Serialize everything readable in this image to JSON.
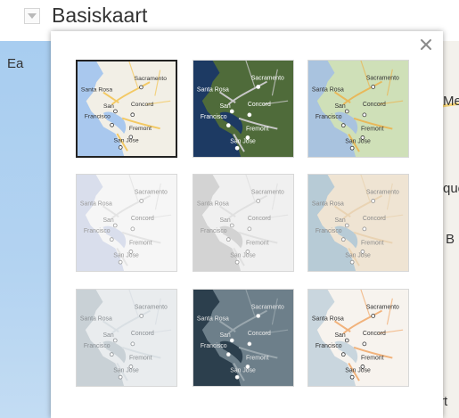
{
  "header": {
    "title": "Basiskaart"
  },
  "background_labels": [
    "Ea",
    "Me",
    "que",
    "B",
    "rt"
  ],
  "tile_labels": [
    "Sacramento",
    "Santa Rosa",
    "San",
    "Francisco",
    "Concord",
    "Fremont",
    "San Jose"
  ],
  "map_styles": [
    {
      "id": "standard",
      "selected": true,
      "water": "#a9c8ee",
      "land": "#f2efe6",
      "road": "#f3c964",
      "text": "#333333"
    },
    {
      "id": "satellite",
      "selected": false,
      "water": "#1d3a63",
      "land": "#4f6b3a",
      "road": "#c8c8c8",
      "text": "#ffffff"
    },
    {
      "id": "terrain",
      "selected": false,
      "water": "#a9c3df",
      "land": "#cfe0b8",
      "road": "#e8b85a",
      "text": "#333333"
    },
    {
      "id": "light",
      "selected": false,
      "water": "#d9deec",
      "land": "#f6f6f6",
      "road": "#e4e4e4",
      "text": "#9a9a9a"
    },
    {
      "id": "grey",
      "selected": false,
      "water": "#d3d3d3",
      "land": "#f0f0f0",
      "road": "#e0e0e0",
      "text": "#999999"
    },
    {
      "id": "beige",
      "selected": false,
      "water": "#b7cbd6",
      "land": "#efe4d3",
      "road": "#e9d3b3",
      "text": "#8a8a8a"
    },
    {
      "id": "blue-grey",
      "selected": false,
      "water": "#c9d1d6",
      "land": "#e9ecee",
      "road": "#d9dfe3",
      "text": "#8a8f93"
    },
    {
      "id": "dark",
      "selected": false,
      "water": "#2c3f4d",
      "land": "#6d7f8a",
      "road": "#9aa7ae",
      "text": "#e8e8e8"
    },
    {
      "id": "vintage",
      "selected": false,
      "water": "#c9d6de",
      "land": "#f7f3ee",
      "road": "#f1b27b",
      "text": "#333333"
    }
  ]
}
